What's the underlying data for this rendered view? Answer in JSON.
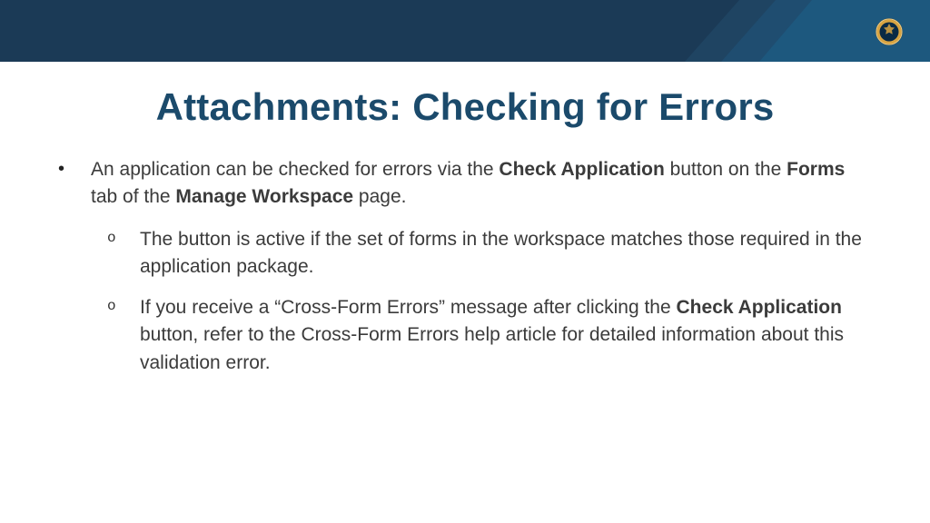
{
  "title": "Attachments: Checking for Errors",
  "bullets": {
    "main": {
      "pre": "An application can be checked for errors via the ",
      "b1": "Check Application",
      "mid1": " button on the ",
      "b2": "Forms",
      "mid2": " tab of the ",
      "b3": "Manage Workspace",
      "post": " page."
    },
    "sub1": "The button is active if the set of forms in the workspace matches those required in the application package.",
    "sub2": {
      "pre": "If you receive a “Cross-Form Errors” message after clicking the ",
      "b1": "Check Application",
      "post": " button, refer to the Cross-Form Errors help article for detailed information about this validation error."
    }
  }
}
